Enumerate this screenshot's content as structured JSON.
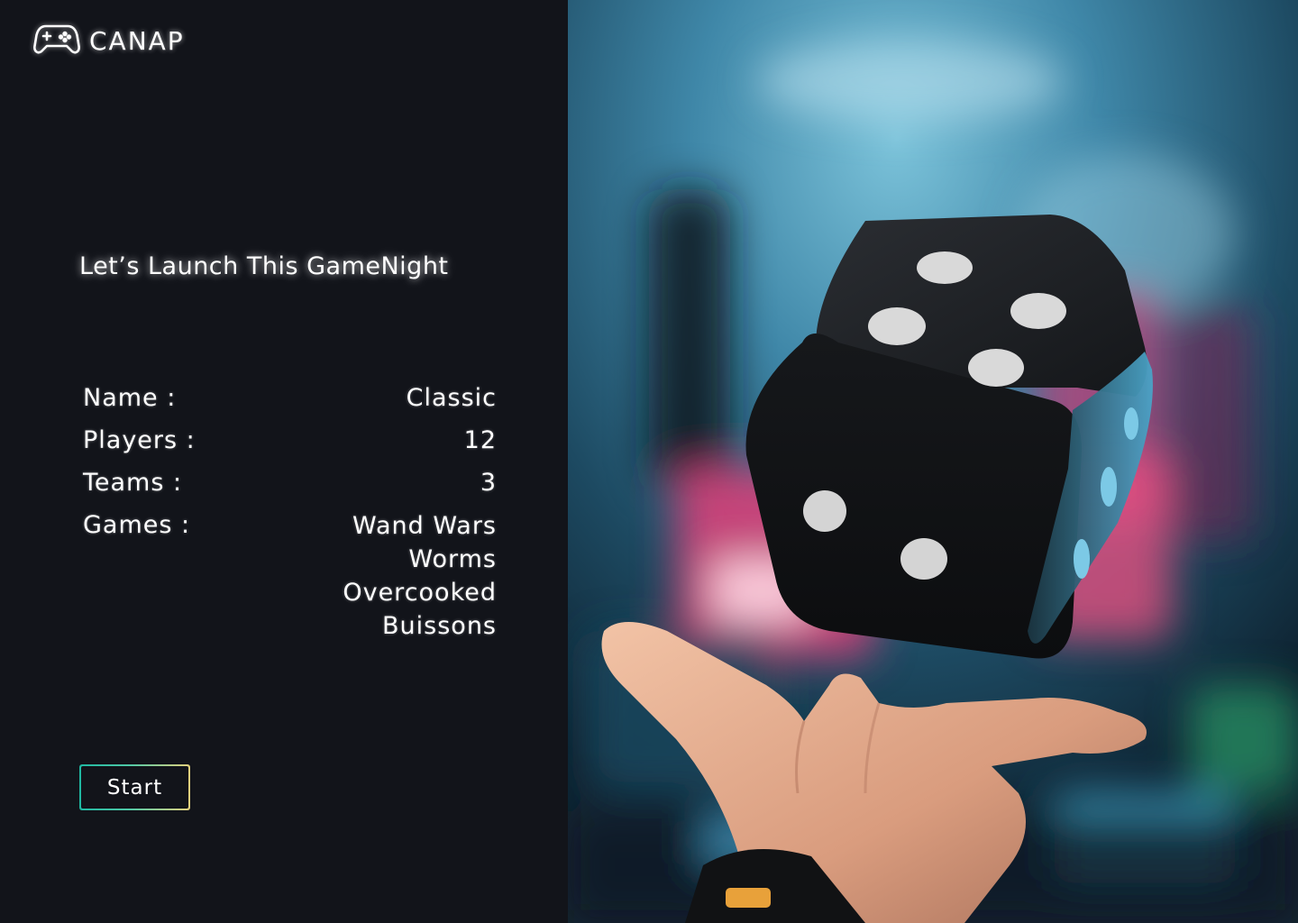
{
  "brand": {
    "name": "CANAP",
    "logo_icon": "gamepad-icon"
  },
  "headline": "Let’s Launch This GameNight",
  "details": {
    "name_label": "Name :",
    "name_value": "Classic",
    "players_label": "Players :",
    "players_value": "12",
    "teams_label": "Teams :",
    "teams_value": "3",
    "games_label": "Games :",
    "games": [
      "Wand Wars",
      "Worms",
      "Overcooked",
      "Buissons"
    ]
  },
  "actions": {
    "start_label": "Start"
  },
  "hero": {
    "image_subject": "hand-tossing-dice-photo"
  },
  "colors": {
    "background": "#12141a",
    "text": "#ffffff",
    "button_gradient_start": "#1fb8a2",
    "button_gradient_end": "#e3cf7c"
  }
}
